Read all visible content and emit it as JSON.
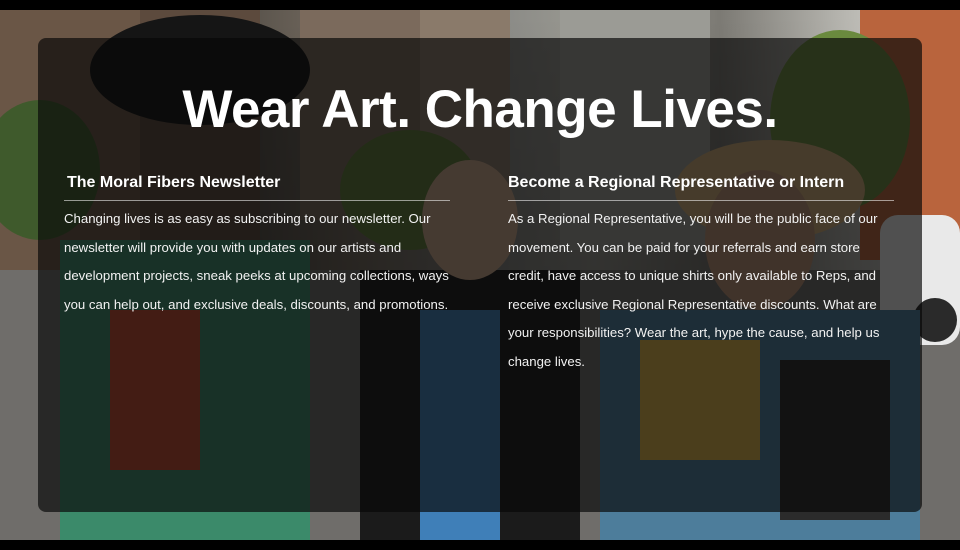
{
  "page": {
    "headline": "Wear Art. Change Lives."
  },
  "newsletter": {
    "title": "The Moral Fibers Newsletter",
    "body": "Changing lives is as easy as subscribing to our newsletter. Our newsletter will provide you with updates on our artists and development projects, sneak peeks at upcoming collections, ways you can help out, and exclusive deals, discounts, and promotions."
  },
  "representative": {
    "title": "Become a Regional Representative or Intern",
    "body": "As a Regional Representative, you will be the public face of our movement. You can be paid for your referrals and earn store credit, have access to unique shirts only available to Reps, and receive exclusive Regional Representative discounts. What are your responsibilities? Wear the art, hype the cause, and help us change lives."
  },
  "colors": {
    "panel_overlay": "#080808",
    "text": "#ffffff"
  }
}
